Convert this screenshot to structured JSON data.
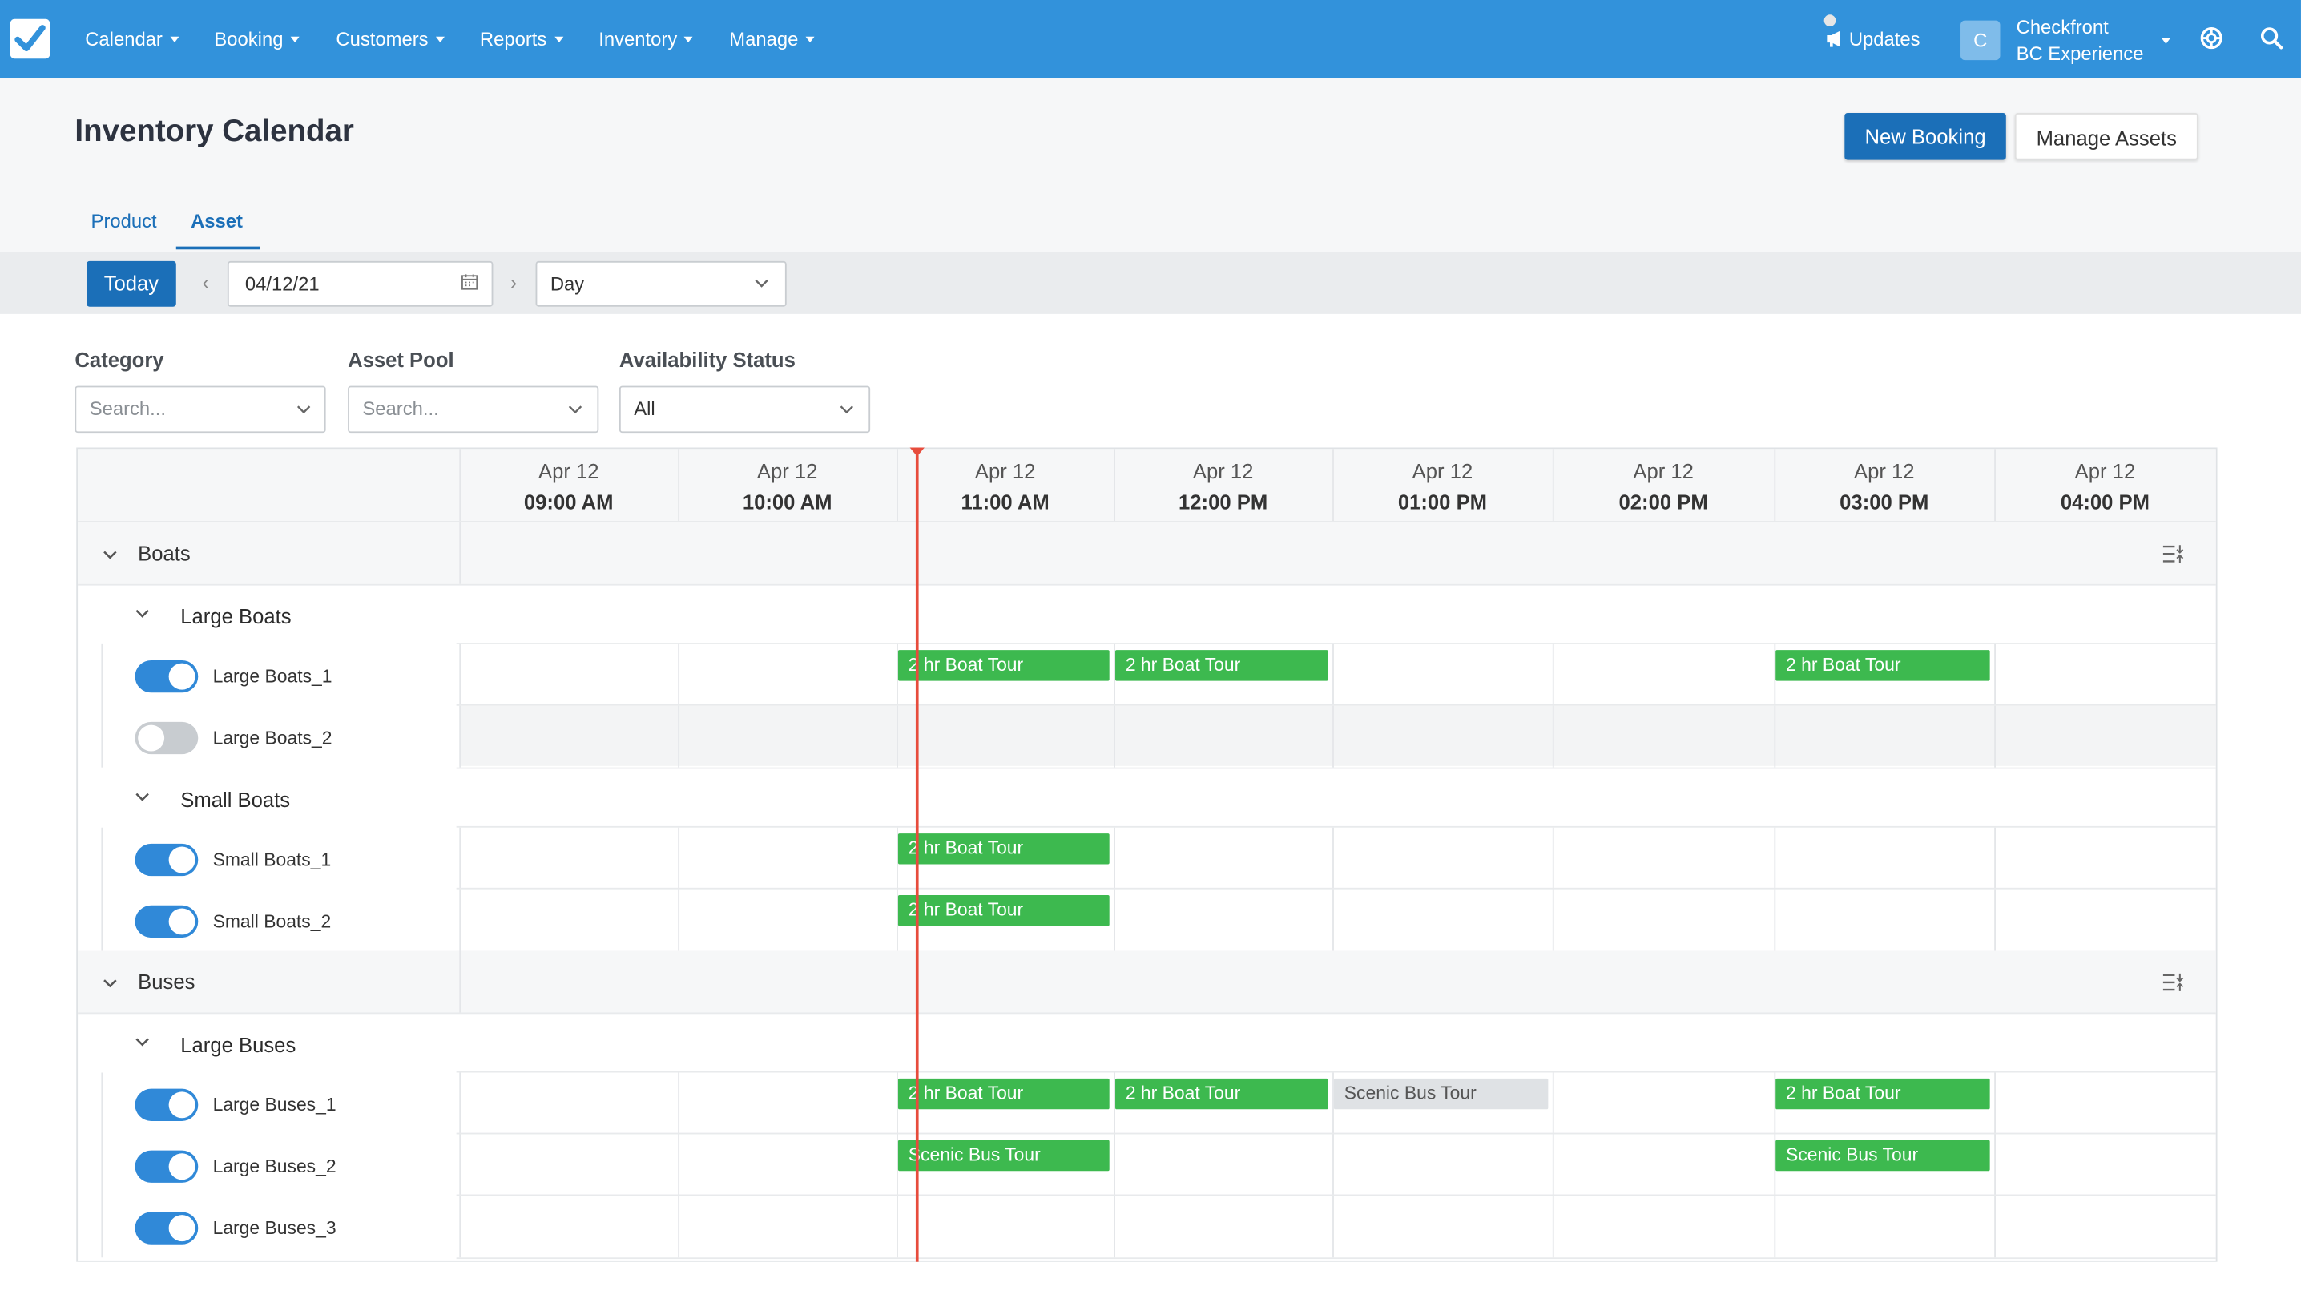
{
  "nav": {
    "items": [
      "Calendar",
      "Booking",
      "Customers",
      "Reports",
      "Inventory",
      "Manage"
    ],
    "updates": "Updates",
    "avatar_letter": "C",
    "account_line1": "Checkfront",
    "account_line2": "BC Experience"
  },
  "header": {
    "title": "Inventory Calendar",
    "new_booking": "New Booking",
    "manage_assets": "Manage Assets"
  },
  "tabs": {
    "product": "Product",
    "asset": "Asset",
    "active": "Asset"
  },
  "toolbar": {
    "today": "Today",
    "date": "04/12/21",
    "view": "Day"
  },
  "filters": {
    "category_label": "Category",
    "category_placeholder": "Search...",
    "pool_label": "Asset Pool",
    "pool_placeholder": "Search...",
    "status_label": "Availability Status",
    "status_value": "All"
  },
  "columns": [
    {
      "date": "Apr 12",
      "time": "09:00 AM"
    },
    {
      "date": "Apr 12",
      "time": "10:00 AM"
    },
    {
      "date": "Apr 12",
      "time": "11:00 AM"
    },
    {
      "date": "Apr 12",
      "time": "12:00 PM"
    },
    {
      "date": "Apr 12",
      "time": "01:00 PM"
    },
    {
      "date": "Apr 12",
      "time": "02:00 PM"
    },
    {
      "date": "Apr 12",
      "time": "03:00 PM"
    },
    {
      "date": "Apr 12",
      "time": "04:00 PM"
    }
  ],
  "groups": [
    {
      "label": "Boats",
      "subgroups": [
        {
          "label": "Large Boats",
          "assets": [
            {
              "label": "Large Boats_1",
              "enabled": true,
              "bookings": [
                {
                  "col": 2,
                  "label": "2 hr Boat Tour",
                  "status": "green"
                },
                {
                  "col": 3,
                  "label": "2 hr Boat Tour",
                  "status": "green"
                },
                {
                  "col": 6,
                  "label": "2 hr Boat Tour",
                  "status": "green"
                }
              ]
            },
            {
              "label": "Large Boats_2",
              "enabled": false,
              "bookings": []
            }
          ]
        },
        {
          "label": "Small Boats",
          "assets": [
            {
              "label": "Small Boats_1",
              "enabled": true,
              "bookings": [
                {
                  "col": 2,
                  "label": "2 hr Boat Tour",
                  "status": "green"
                }
              ]
            },
            {
              "label": "Small Boats_2",
              "enabled": true,
              "bookings": [
                {
                  "col": 2,
                  "label": "2 hr Boat Tour",
                  "status": "green"
                }
              ]
            }
          ]
        }
      ]
    },
    {
      "label": "Buses",
      "subgroups": [
        {
          "label": "Large Buses",
          "assets": [
            {
              "label": "Large Buses_1",
              "enabled": true,
              "bookings": [
                {
                  "col": 2,
                  "label": "2 hr Boat Tour",
                  "status": "green"
                },
                {
                  "col": 3,
                  "label": "2 hr Boat Tour",
                  "status": "green"
                },
                {
                  "col": 4,
                  "label": "Scenic Bus Tour",
                  "status": "gray"
                },
                {
                  "col": 6,
                  "label": "2 hr Boat Tour",
                  "status": "green"
                }
              ]
            },
            {
              "label": "Large Buses_2",
              "enabled": true,
              "bookings": [
                {
                  "col": 2,
                  "label": "Scenic Bus Tour",
                  "status": "green"
                },
                {
                  "col": 6,
                  "label": "Scenic Bus Tour",
                  "status": "green"
                }
              ]
            },
            {
              "label": "Large Buses_3",
              "enabled": true,
              "bookings": []
            }
          ]
        }
      ]
    }
  ],
  "colors": {
    "topbar": "#3292db",
    "primary": "#1b6fb8",
    "booked": "#3db94f",
    "pending": "#dfe2e5",
    "now_line": "#e74c3c"
  },
  "icons": {
    "logo": "check-logo-icon",
    "updates": "megaphone-icon",
    "help": "lifebuoy-icon",
    "search": "search-icon",
    "calendar": "calendar-icon",
    "filter": "sort-filter-icon"
  }
}
